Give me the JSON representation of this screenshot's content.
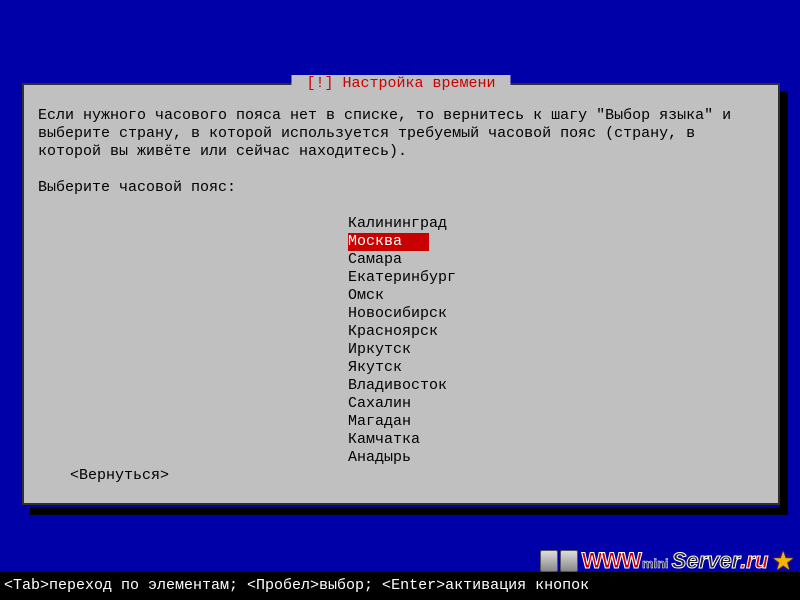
{
  "dialog": {
    "title": " [!] Настройка времени ",
    "instructions": "Если нужного часового пояса нет в списке, то вернитесь к шагу \"Выбор языка\" и выберите страну, в которой используется требуемый часовой пояс (страну, в которой вы живёте или сейчас находитесь).",
    "prompt": "Выберите часовой пояс:",
    "timezones": [
      "Калининград",
      "Москва",
      "Самара",
      "Екатеринбург",
      "Омск",
      "Новосибирск",
      "Красноярск",
      "Иркутск",
      "Якутск",
      "Владивосток",
      "Сахалин",
      "Магадан",
      "Камчатка",
      "Анадырь"
    ],
    "selected_index": 1,
    "back_label": "<Вернуться>"
  },
  "bottom_hint": "<Tab>переход по элементам; <Пробел>выбор; <Enter>активация кнопок",
  "logo": {
    "www": "WWW",
    "mini": "mini",
    "server": "Server",
    "ru": ".ru"
  }
}
